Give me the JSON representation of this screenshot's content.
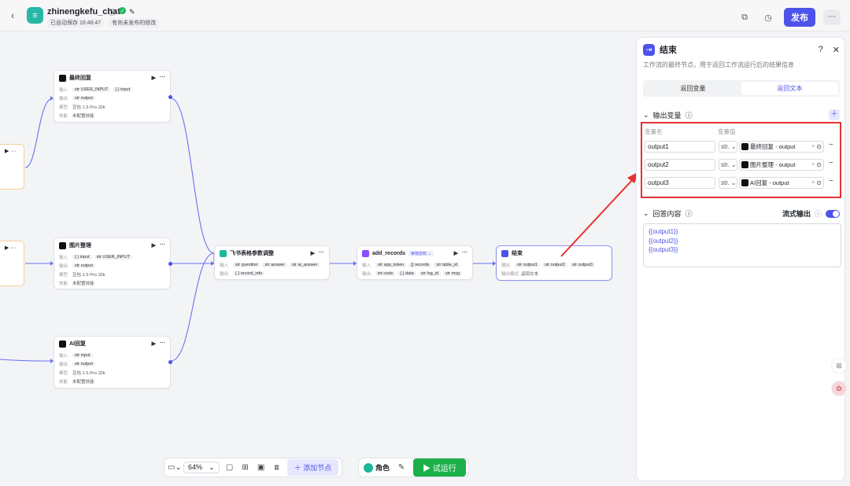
{
  "header": {
    "title": "zhinengkefu_chat",
    "autosave": "已自动保存 16:46:47",
    "unpublished": "有尚未发布的修改",
    "publish_label": "发布"
  },
  "nodes": {
    "final_reply": {
      "title": "最终回复",
      "input_label": "输入",
      "inputs": [
        "str USER_INPUT",
        "{.} input"
      ],
      "output_label": "输出",
      "outputs": [
        "str output"
      ],
      "model_label": "模型",
      "model": "豆包·1.5·Pro·32k",
      "skill_label": "技能",
      "skill": "未配置技能"
    },
    "image_organize": {
      "title": "图片整理",
      "input_label": "输入",
      "inputs": [
        "{.} input",
        "str USER_INPUT"
      ],
      "output_label": "输出",
      "outputs": [
        "str output"
      ],
      "model_label": "模型",
      "model": "豆包·1.5·Pro·32k",
      "skill_label": "技能",
      "skill": "未配置技能"
    },
    "ai_reply": {
      "title": "AI回复",
      "input_label": "输入",
      "inputs": [
        "str input"
      ],
      "output_label": "输出",
      "outputs": [
        "str output"
      ],
      "model_label": "模型",
      "model": "豆包·1.5·Pro·32k",
      "skill_label": "技能",
      "skill": "未配置技能"
    },
    "feishu": {
      "title": "飞书表格参数调整",
      "input_label": "输入",
      "inputs": [
        "str question",
        "str answer",
        "str ai_answer"
      ],
      "output_label": "输出",
      "outputs": [
        "{.} record_info"
      ]
    },
    "add_records": {
      "title": "add_records",
      "badge": "审核授权 ⌄",
      "input_label": "输入",
      "inputs": [
        "str app_token",
        "[] records",
        "str table_id"
      ],
      "output_label": "输出",
      "outputs": [
        "int code",
        "{.} data",
        "str log_id",
        "str msg"
      ]
    },
    "end": {
      "title": "结束",
      "output_label": "输出",
      "outputs": [
        "str output1",
        "str output2",
        "str output3"
      ],
      "mode_label": "输出模式",
      "mode": "返回文本"
    }
  },
  "toolbar": {
    "zoom": "64%",
    "add_node": "添加节点",
    "role": "角色",
    "run": "试运行"
  },
  "panel": {
    "title": "结束",
    "description": "工作流的最终节点，用于返回工作流运行后的结果信息",
    "tabs": [
      "返回变量",
      "返回文本"
    ],
    "active_tab": 1,
    "output_section": "输出变量",
    "col_name": "变量名",
    "col_value": "变量值",
    "variables": [
      {
        "name": "output1",
        "type": "str.",
        "value": "最终回复 - output"
      },
      {
        "name": "output2",
        "type": "str.",
        "value": "图片整理 - output"
      },
      {
        "name": "output3",
        "type": "str.",
        "value": "AI回复 - output"
      }
    ],
    "answer_section": "回答内容",
    "stream_label": "流式输出",
    "answer_lines": [
      "{{output1}}",
      "{{output2}}",
      "{{output3}}"
    ]
  },
  "colors": {
    "accent": "#4d53e8",
    "run": "#1cb04a",
    "highlight": "#e63232"
  }
}
